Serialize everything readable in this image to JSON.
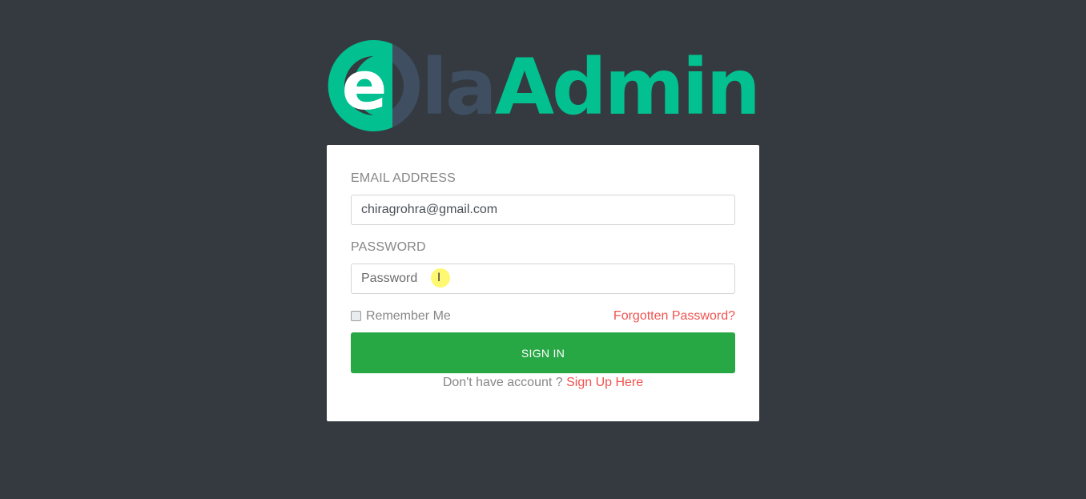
{
  "logo": {
    "letter": "e",
    "text_part1": "la",
    "text_part2": "Admin",
    "colors": {
      "brand_green": "#02c08f",
      "brand_slate": "#3f4e60"
    }
  },
  "form": {
    "email_label": "EMAIL ADDRESS",
    "email_value": "chiragrohra@gmail.com",
    "password_label": "PASSWORD",
    "password_value": "",
    "password_placeholder": "Password",
    "remember_label": "Remember Me",
    "remember_checked": false,
    "forgot_link": "Forgotten Password?",
    "submit_label": "SIGN IN",
    "signup_prompt": "Don't have account ?",
    "signup_link": "Sign Up Here"
  },
  "cursor": {
    "icon": "text-cursor-icon",
    "glyph": "I"
  },
  "colors": {
    "background": "#343a40",
    "card": "#ffffff",
    "primary_button": "#28a745",
    "link_accent": "#ef5350",
    "label_text": "#878787"
  }
}
